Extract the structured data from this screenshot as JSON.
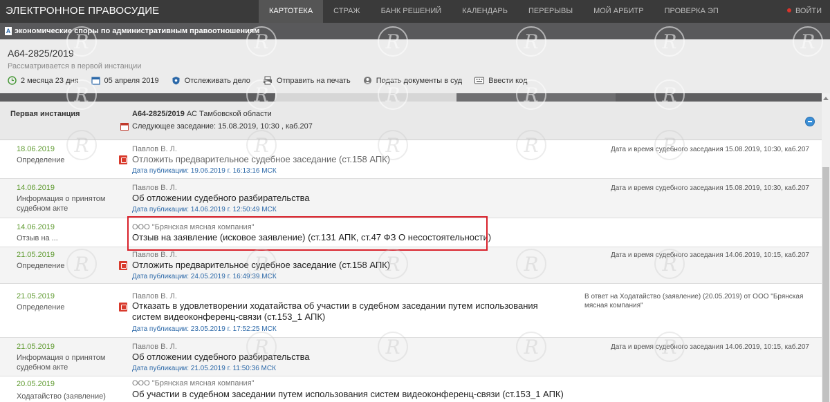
{
  "topbar": {
    "brand": "ЭЛЕКТРОННОЕ ПРАВОСУДИЕ",
    "nav": [
      "КАРТОТЕКА",
      "СТРАЖ",
      "БАНК РЕШЕНИЙ",
      "КАЛЕНДАРЬ",
      "ПЕРЕРЫВЫ",
      "МОЙ АРБИТР",
      "ПРОВЕРКА ЭП"
    ],
    "active": "КАРТОТЕКА",
    "logout": "ВОЙТИ"
  },
  "category": {
    "icon": "А",
    "text": "экономические споры по административным правоотношениям"
  },
  "case": {
    "number": "А64-2825/2019",
    "status": "Рассматривается в первой инстанции",
    "toolbar": {
      "duration": "2 месяца 23 дня",
      "date": "05 апреля 2019",
      "track": "Отслеживать дело",
      "print": "Отправить на печать",
      "submit": "Подать документы в суд",
      "code": "Ввести код"
    }
  },
  "instance": {
    "title": "Первая инстанция",
    "case_number": "А64-2825/2019",
    "court": "АС Тамбовской области",
    "next_hearing": "Следующее заседание: 15.08.2019, 10:30 , каб.207"
  },
  "documents": [
    {
      "date": "18.06.2019",
      "type": "Определение",
      "author": "Павлов В. Л.",
      "title": "Отложить предварительное судебное заседание (ст.158 АПК)",
      "published": "Дата публикации: 19.06.2019 г. 16:13:16 МСК",
      "note": "Дата и время судебного заседания 15.08.2019, 10:30, каб.207"
    },
    {
      "date": "14.06.2019",
      "type": "Информация о принятом судебном акте",
      "author": "Павлов В. Л.",
      "title": "Об отложении судебного разбирательства",
      "published": "Дата публикации: 14.06.2019 г. 12:50:49 МСК",
      "note": "Дата и время судебного заседания 15.08.2019, 10:30, каб.207"
    },
    {
      "date": "14.06.2019",
      "type": "Отзыв на ...",
      "author": "ООО \"Брянская мясная компания\"",
      "title": "Отзыв на заявление (исковое заявление) (ст.131 АПК, ст.47 ФЗ О несостоятельности)",
      "published": "",
      "note": ""
    },
    {
      "date": "21.05.2019",
      "type": "Определение",
      "author": "Павлов В. Л.",
      "title": "Отложить предварительное судебное заседание (ст.158 АПК)",
      "published": "Дата публикации: 24.05.2019 г. 16:49:39 МСК",
      "note": "Дата и время судебного заседания 14.06.2019, 10:15, каб.207"
    },
    {
      "date": "21.05.2019",
      "type": "Определение",
      "author": "Павлов В. Л.",
      "title": "Отказать в удовлетворении ходатайства об участии в судебном заседании путем использования систем видеоконференц-связи (ст.153_1 АПК)",
      "published": "Дата публикации: 23.05.2019 г. 17:52:25 МСК",
      "note": "В ответ на Ходатайство (заявление) (20.05.2019) от ООО \"Брянская мясная компания\""
    },
    {
      "date": "21.05.2019",
      "type": "Информация о принятом судебном акте",
      "author": "Павлов В. Л.",
      "title": "Об отложении судебного разбирательства",
      "published": "Дата публикации: 21.05.2019 г. 11:50:36 МСК",
      "note": "Дата и время судебного заседания 14.06.2019, 10:15, каб.207"
    },
    {
      "date": "20.05.2019",
      "type": "Ходатайство (заявление)",
      "author": "ООО \"Брянская мясная компания\"",
      "title": "Об участии в судебном заседании путем использования систем видеоконференц-связи (ст.153_1 АПК)",
      "published": "",
      "note": ""
    }
  ]
}
